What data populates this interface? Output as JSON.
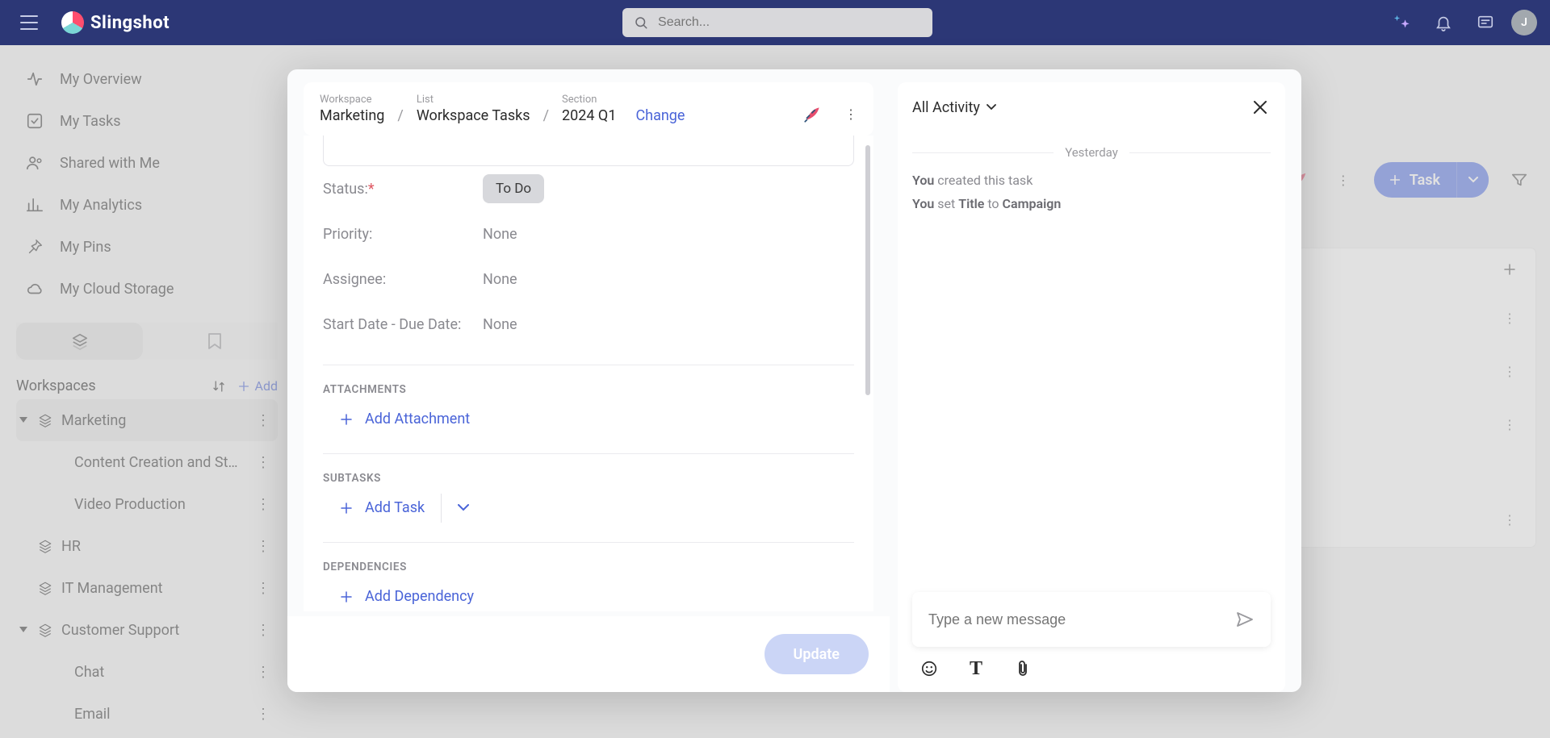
{
  "brand": "Slingshot",
  "search": {
    "placeholder": "Search..."
  },
  "avatar_initial": "J",
  "nav": [
    {
      "label": "My Overview"
    },
    {
      "label": "My Tasks"
    },
    {
      "label": "Shared with Me"
    },
    {
      "label": "My Analytics"
    },
    {
      "label": "My Pins"
    },
    {
      "label": "My Cloud Storage"
    }
  ],
  "workspaces_header": {
    "title": "Workspaces",
    "add_label": "Add"
  },
  "tree": {
    "marketing": {
      "label": "Marketing"
    },
    "content": {
      "label": "Content Creation and States"
    },
    "video": {
      "label": "Video Production"
    },
    "hr": {
      "label": "HR"
    },
    "it": {
      "label": "IT Management"
    },
    "cs": {
      "label": "Customer Support"
    },
    "chat": {
      "label": "Chat"
    },
    "email": {
      "label": "Email"
    }
  },
  "toolbar": {
    "task_button": "Task"
  },
  "breadcrumb": {
    "workspace_top": "Workspace",
    "workspace_val": "Marketing",
    "list_top": "List",
    "list_val": "Workspace Tasks",
    "section_top": "Section",
    "section_val": "2024 Q1",
    "change": "Change"
  },
  "fields": {
    "status_label": "Status:",
    "status_value": "To Do",
    "priority_label": "Priority:",
    "priority_value": "None",
    "assignee_label": "Assignee:",
    "assignee_value": "None",
    "dates_label": "Start Date - Due Date:",
    "dates_value": "None"
  },
  "sections": {
    "attachments": "ATTACHMENTS",
    "subtasks": "SUBTASKS",
    "dependencies": "DEPENDENCIES"
  },
  "actions": {
    "add_attachment": "Add Attachment",
    "add_task": "Add Task",
    "add_dependency": "Add Dependency",
    "update": "Update"
  },
  "activity": {
    "header": "All Activity",
    "day": "Yesterday",
    "log1_actor": "You",
    "log1_rest": " created this task",
    "log2_actor": "You",
    "log2_p1": " set ",
    "log2_b1": "Title",
    "log2_p2": " to ",
    "log2_b2": "Campaign",
    "msg_placeholder": "Type a new message"
  }
}
